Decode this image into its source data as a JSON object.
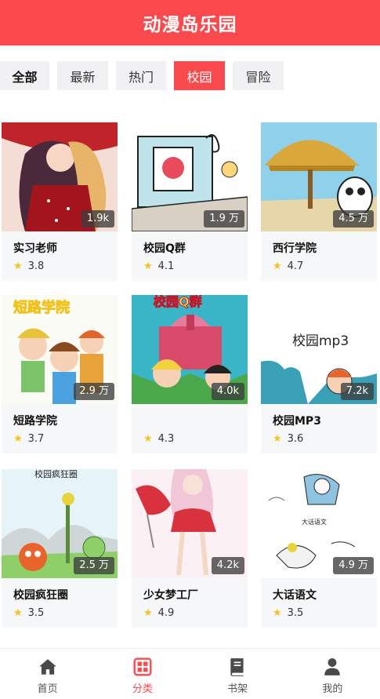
{
  "header": {
    "title": "动漫岛乐园"
  },
  "tabs": [
    {
      "label": "全部"
    },
    {
      "label": "最新"
    },
    {
      "label": "热门"
    },
    {
      "label": "校园"
    },
    {
      "label": "冒险"
    }
  ],
  "cards": [
    {
      "title": "实习老师",
      "rating": "3.8",
      "count": "1.9k"
    },
    {
      "title": "校园Q群",
      "rating": "4.1",
      "count": "1.9 万"
    },
    {
      "title": "西行学院",
      "rating": "4.7",
      "count": "4.5 万"
    },
    {
      "title": "短路学院",
      "rating": "3.7",
      "count": "2.9 万",
      "cover_text": "短路学院"
    },
    {
      "title": "",
      "rating": "4.3",
      "count": "4.0k",
      "cover_text": "校园Q群"
    },
    {
      "title": "校园MP3",
      "rating": "3.6",
      "count": "7.2k",
      "cover_text": "校园mp3"
    },
    {
      "title": "校园疯狂圈",
      "rating": "3.5",
      "count": "2.5 万",
      "cover_text": "校园疯狂圈"
    },
    {
      "title": "少女梦工厂",
      "rating": "4.9",
      "count": "4.2k"
    },
    {
      "title": "大话语文",
      "rating": "3.5",
      "count": "4.9 万",
      "cover_text": "大话语文"
    }
  ],
  "bottom_nav": [
    {
      "label": "首页",
      "icon": "home-icon"
    },
    {
      "label": "分类",
      "icon": "category-icon"
    },
    {
      "label": "书架",
      "icon": "bookshelf-icon"
    },
    {
      "label": "我的",
      "icon": "user-icon"
    }
  ],
  "colors": {
    "accent": "#fb4a4e",
    "star": "#f6c21c",
    "card_bg": "#f6f7f9",
    "tab_bg": "#f1f1f3"
  },
  "active_tab": "校园",
  "active_nav": "分类"
}
